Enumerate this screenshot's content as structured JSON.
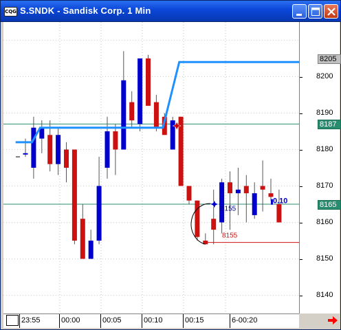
{
  "window": {
    "title": "S.SNDK - Sandisk Corp. 1 Min",
    "app_icon_text": "CQG",
    "buttons": [
      "minimize-button",
      "maximize-button",
      "close-button"
    ]
  },
  "price_axis": {
    "labels": [
      "8200",
      "8190",
      "8180",
      "8170",
      "8160",
      "8150",
      "8140"
    ],
    "badges": [
      {
        "text": "8205",
        "color": "#c0c0c0"
      },
      {
        "text": "8187",
        "color": "#2a8c6e"
      },
      {
        "text": "8165",
        "color": "#2a8c6e"
      }
    ]
  },
  "time_axis": {
    "labels": [
      "23:55",
      "00:00",
      "00:05",
      "00:10",
      "00:15",
      "6-00:20"
    ]
  },
  "annotations": {
    "blue_label": "8155",
    "red_label": "8155",
    "current_value": "0.10"
  },
  "colors": {
    "up": "#0000cc",
    "down": "#cc1111",
    "ma_line": "#1e90ff",
    "hline": "#2a8c6e",
    "red_line": "#cc1111"
  },
  "chart_data": {
    "type": "candlestick",
    "price_range": [
      8135,
      8215
    ],
    "horizontal_lines": [
      8187,
      8165
    ],
    "candles": [
      {
        "o": 8179,
        "h": 8183,
        "l": 8178,
        "c": 8179,
        "dir": "up"
      },
      {
        "o": 8175,
        "h": 8189,
        "l": 8172,
        "c": 8186,
        "dir": "up"
      },
      {
        "o": 8186,
        "h": 8188,
        "l": 8179,
        "c": 8183,
        "dir": "up"
      },
      {
        "o": 8184,
        "h": 8188,
        "l": 8174,
        "c": 8176,
        "dir": "down"
      },
      {
        "o": 8176,
        "h": 8186,
        "l": 8173,
        "c": 8184,
        "dir": "up"
      },
      {
        "o": 8180,
        "h": 8182,
        "l": 8171,
        "c": 8175,
        "dir": "down"
      },
      {
        "o": 8180,
        "h": 8180,
        "l": 8154,
        "c": 8155,
        "dir": "down"
      },
      {
        "o": 8161,
        "h": 8165,
        "l": 8150,
        "c": 8150,
        "dir": "down"
      },
      {
        "o": 8150,
        "h": 8158,
        "l": 8150,
        "c": 8155,
        "dir": "up"
      },
      {
        "o": 8155,
        "h": 8178,
        "l": 8154,
        "c": 8170,
        "dir": "up"
      },
      {
        "o": 8175,
        "h": 8189,
        "l": 8172,
        "c": 8185,
        "dir": "up"
      },
      {
        "o": 8185,
        "h": 8187,
        "l": 8173,
        "c": 8180,
        "dir": "down"
      },
      {
        "o": 8180,
        "h": 8207,
        "l": 8180,
        "c": 8199,
        "dir": "up"
      },
      {
        "o": 8193,
        "h": 8196,
        "l": 8186,
        "c": 8188,
        "dir": "down"
      },
      {
        "o": 8187,
        "h": 8205,
        "l": 8185,
        "c": 8205,
        "dir": "up"
      },
      {
        "o": 8205,
        "h": 8206,
        "l": 8193,
        "c": 8192,
        "dir": "down"
      },
      {
        "o": 8193,
        "h": 8195,
        "l": 8185,
        "c": 8186,
        "dir": "down"
      },
      {
        "o": 8189,
        "h": 8190,
        "l": 8184,
        "c": 8184,
        "dir": "down"
      },
      {
        "o": 8188,
        "h": 8189,
        "l": 8180,
        "c": 8180,
        "dir": "up"
      },
      {
        "o": 8189,
        "h": 8189,
        "l": 8170,
        "c": 8170,
        "dir": "down"
      },
      {
        "o": 8170,
        "h": 8170,
        "l": 8165,
        "c": 8166,
        "dir": "down"
      },
      {
        "o": 8166,
        "h": 8166,
        "l": 8155,
        "c": 8156,
        "dir": "down"
      },
      {
        "o": 8155,
        "h": 8157,
        "l": 8154,
        "c": 8154,
        "dir": "down"
      },
      {
        "o": 8158,
        "h": 8169,
        "l": 8154,
        "c": 8161,
        "dir": "down"
      },
      {
        "o": 8160,
        "h": 8172,
        "l": 8157,
        "c": 8171,
        "dir": "up"
      },
      {
        "o": 8171,
        "h": 8174,
        "l": 8158,
        "c": 8168,
        "dir": "down"
      },
      {
        "o": 8168,
        "h": 8175,
        "l": 8162,
        "c": 8169,
        "dir": "up"
      },
      {
        "o": 8170,
        "h": 8173,
        "l": 8160,
        "c": 8168,
        "dir": "down"
      },
      {
        "o": 8168,
        "h": 8171,
        "l": 8161,
        "c": 8162,
        "dir": "up"
      },
      {
        "o": 8170,
        "h": 8177,
        "l": 8163,
        "c": 8169,
        "dir": "down"
      },
      {
        "o": 8168,
        "h": 8172,
        "l": 8166,
        "c": 8167,
        "dir": "down"
      },
      {
        "o": 8165,
        "h": 8169,
        "l": 8163,
        "c": 8160,
        "dir": "down"
      }
    ],
    "ma_line": [
      [
        0,
        8182
      ],
      [
        2,
        8182
      ],
      [
        3,
        8186
      ],
      [
        18,
        8186
      ],
      [
        19,
        8195
      ],
      [
        20,
        8204
      ],
      [
        36,
        8204
      ]
    ]
  }
}
